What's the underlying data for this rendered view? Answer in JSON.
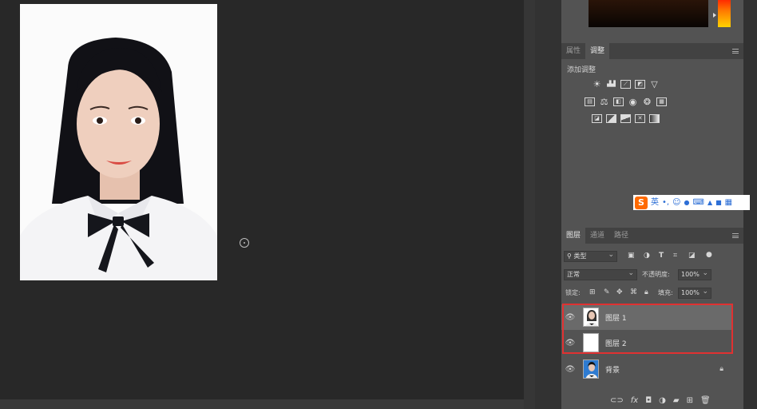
{
  "document": {
    "photo_alt": "portrait"
  },
  "adjustments_panel": {
    "tabs": [
      {
        "label": "属性"
      },
      {
        "label": "调整"
      }
    ],
    "add_adjustment_label": "添加调整",
    "icon_rows": [
      [
        "brightness-contrast-icon",
        "levels-icon",
        "curves-icon",
        "exposure-icon",
        "vibrance-icon"
      ],
      [
        "hue-saturation-icon",
        "color-balance-icon",
        "black-white-icon",
        "photo-filter-icon",
        "channel-mixer-icon",
        "color-lookup-icon"
      ],
      [
        "invert-icon",
        "posterize-icon",
        "threshold-icon",
        "selective-color-icon",
        "gradient-map-icon"
      ]
    ]
  },
  "ime_bar": {
    "logo": "S",
    "mode": "英",
    "items": [
      "•,",
      "☺",
      "🎤",
      "⌨",
      "👕",
      "👔",
      "▦"
    ]
  },
  "layers_panel": {
    "tabs": [
      {
        "label": "图层"
      },
      {
        "label": "通道"
      },
      {
        "label": "路径"
      }
    ],
    "filter_kind": "类型",
    "blend_mode": "正常",
    "opacity_label": "不透明度:",
    "opacity_value": "100%",
    "lock_label": "锁定:",
    "fill_label": "填充:",
    "fill_value": "100%",
    "layers": [
      {
        "name": "图层 1",
        "selected": true
      },
      {
        "name": "图层 2",
        "selected": false
      },
      {
        "name": "背景",
        "selected": false,
        "locked": true
      }
    ],
    "bottom_icons": [
      "link-icon",
      "fx-icon",
      "mask-icon",
      "adjustment-icon",
      "folder-icon",
      "new-layer-icon",
      "trash-icon"
    ]
  },
  "colors": {
    "highlight": "#e03131",
    "panel_bg": "#535353",
    "canvas_bg": "#282828"
  }
}
